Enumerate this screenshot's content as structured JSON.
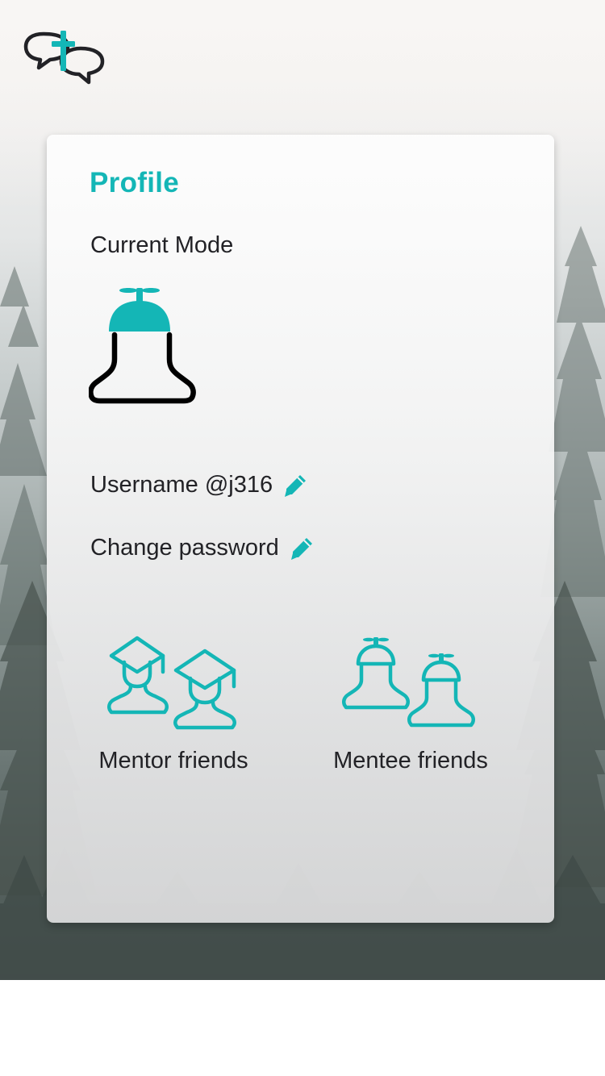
{
  "app": {
    "logo_icon": "chat-bubbles-cross-icon"
  },
  "profile": {
    "title": "Profile",
    "current_mode_label": "Current Mode",
    "current_mode_icon": "mentee-propeller-cap-avatar-icon",
    "username_label": "Username @j316",
    "username_edit_icon": "pencil-icon",
    "password_label": "Change password",
    "password_edit_icon": "pencil-icon"
  },
  "friends": {
    "mentor_label": "Mentor friends",
    "mentor_icon": "mentor-graduation-cap-group-icon",
    "mentee_label": "Mentee friends",
    "mentee_icon": "mentee-propeller-cap-group-icon"
  },
  "colors": {
    "accent": "#14b6b6",
    "text": "#222226",
    "icon_dark": "#000000"
  }
}
